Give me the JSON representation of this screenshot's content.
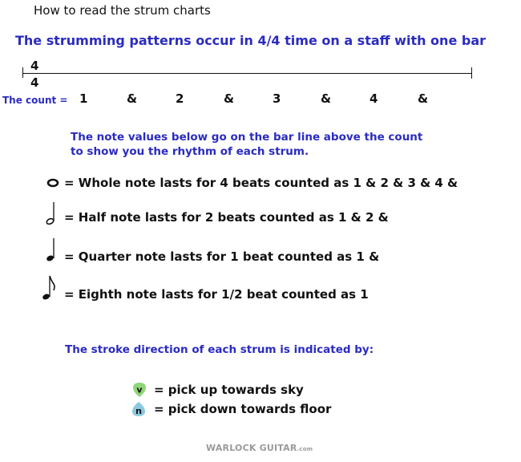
{
  "header": {
    "title": "How to read the strum charts",
    "subtitle": "The strumming patterns occur in 4/4 time on a staff with one bar"
  },
  "staff": {
    "time_signature": {
      "top": "4",
      "bottom": "4"
    },
    "count_label": "The count =",
    "count": [
      "1",
      "&",
      "2",
      "&",
      "3",
      "&",
      "4",
      "&"
    ]
  },
  "notes": {
    "intro_line1": "The note values below go on the bar line above the count",
    "intro_line2": "to show you the rhythm of each strum.",
    "items": [
      {
        "icon": "whole-note-icon",
        "text": "= Whole note lasts for 4 beats counted as 1 & 2 & 3 & 4 &"
      },
      {
        "icon": "half-note-icon",
        "text": "= Half note lasts for 2 beats counted as 1 & 2 &"
      },
      {
        "icon": "quarter-note-icon",
        "text": "= Quarter note lasts for 1 beat counted as 1 &"
      },
      {
        "icon": "eighth-note-icon",
        "text": "= Eighth note lasts for 1/2 beat counted as 1"
      }
    ]
  },
  "strokes": {
    "intro": "The stroke direction of each strum is indicated by:",
    "items": [
      {
        "icon": "pick-up-icon",
        "glyph": "v",
        "color": "#8fd67a",
        "text": "= pick up towards sky"
      },
      {
        "icon": "pick-down-icon",
        "glyph": "n",
        "color": "#8cc8e0",
        "text": "= pick down towards floor"
      }
    ]
  },
  "footer": {
    "logo_main": "WARLOCK GUITAR",
    "logo_suffix": ".com"
  }
}
